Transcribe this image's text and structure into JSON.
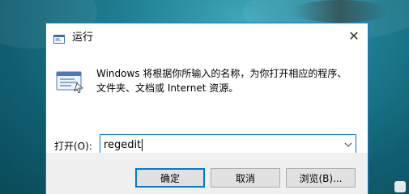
{
  "window": {
    "title": "运行",
    "close_glyph": "✕"
  },
  "description": {
    "line1": "Windows 将根据你所输入的名称，为你打开相应的程序、",
    "line2": "文件夹、文档或 Internet 资源。"
  },
  "open_field": {
    "label": "打开(O):",
    "value": "regedit"
  },
  "buttons": {
    "ok": "确定",
    "cancel": "取消",
    "browse": "浏览(B)..."
  },
  "icons": {
    "title": "run-dialog-icon",
    "body": "run-program-icon",
    "close": "close-icon",
    "dropdown": "chevron-down-icon"
  },
  "colors": {
    "accent": "#0078d7",
    "window_border": "#1979ca",
    "footer_bg": "#f0f0f0",
    "button_bg": "#e1e1e1"
  }
}
